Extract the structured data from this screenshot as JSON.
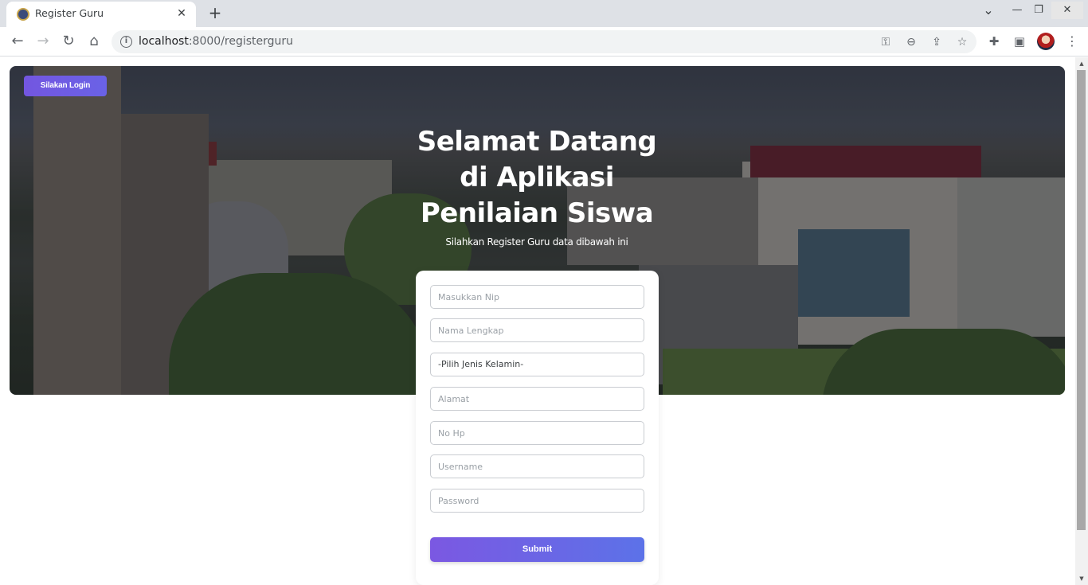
{
  "browser": {
    "tab_title": "Register Guru",
    "tab_close": "✕",
    "new_tab": "+",
    "url_host": "localhost",
    "url_rest": ":8000/registerguru",
    "window": {
      "minimize": "—",
      "restore": "❐",
      "close": "✕",
      "tab_menu": "⌄"
    },
    "nav": {
      "back": "←",
      "forward": "→",
      "reload": "↻",
      "home": "⌂",
      "info": "i"
    },
    "icons": {
      "key": "⚿",
      "zoom": "⊖",
      "share": "⇪",
      "star": "☆",
      "extensions": "✚",
      "sidepanel": "▣",
      "menu": "⋮"
    }
  },
  "page": {
    "login_button": "Silakan Login",
    "hero": {
      "title": "Selamat Datang di Aplikasi Penilaian Siswa",
      "subtitle": "Silahkan Register Guru data dibawah ini"
    },
    "form": {
      "nip_placeholder": "Masukkan Nip",
      "nama_placeholder": "Nama Lengkap",
      "gender_selected": "-Pilih Jenis Kelamin-",
      "alamat_placeholder": "Alamat",
      "nohp_placeholder": "No Hp",
      "username_placeholder": "Username",
      "password_placeholder": "Password",
      "submit_label": "Submit"
    }
  },
  "colors": {
    "accent_start": "#7b58e2",
    "accent_end": "#5c72e8",
    "chrome_bg": "#dee1e6"
  }
}
